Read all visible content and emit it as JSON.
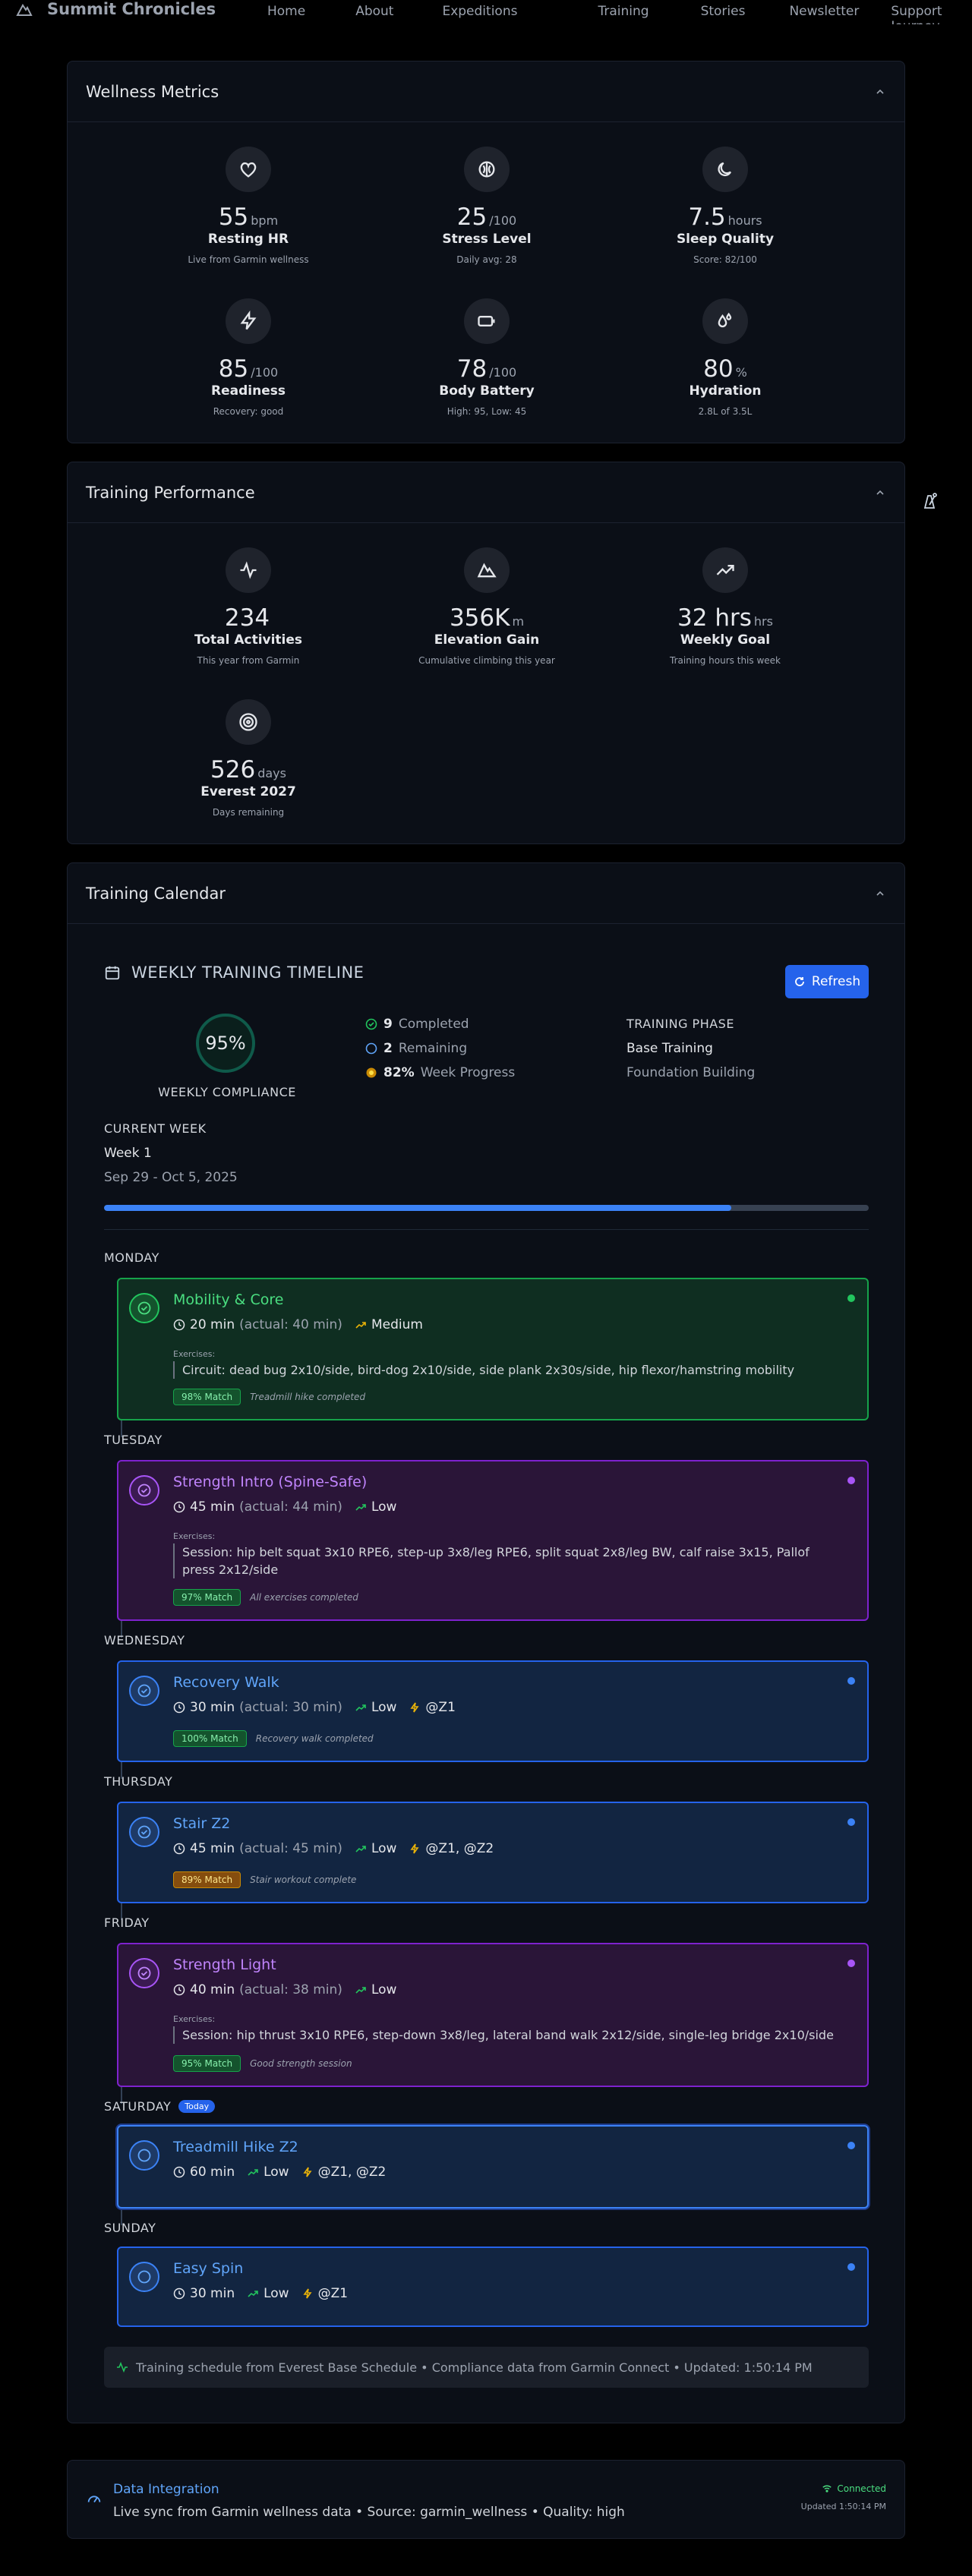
{
  "nav": {
    "brand": "Summit Chronicles",
    "links": [
      "Home",
      "About",
      "Expeditions",
      "Training",
      "Stories",
      "Newsletter",
      "Support Journey"
    ]
  },
  "wellness": {
    "title": "Wellness Metrics",
    "metrics": [
      {
        "icon": "heart-icon",
        "value": "55",
        "unit": "bpm",
        "label": "Resting HR",
        "sub": "Live from Garmin wellness"
      },
      {
        "icon": "brain-icon",
        "value": "25",
        "unit": "/100",
        "label": "Stress Level",
        "sub": "Daily avg: 28"
      },
      {
        "icon": "moon-icon",
        "value": "7.5",
        "unit": "hours",
        "label": "Sleep Quality",
        "sub": "Score: 82/100"
      },
      {
        "icon": "bolt-icon",
        "value": "85",
        "unit": "/100",
        "label": "Readiness",
        "sub": "Recovery: good"
      },
      {
        "icon": "battery-icon",
        "value": "78",
        "unit": "/100",
        "label": "Body Battery",
        "sub": "High: 95, Low: 45"
      },
      {
        "icon": "droplets-icon",
        "value": "80",
        "unit": "%",
        "label": "Hydration",
        "sub": "2.8L of 3.5L"
      }
    ]
  },
  "performance": {
    "title": "Training Performance",
    "metrics": [
      {
        "icon": "activity-icon",
        "value": "234",
        "unit": "",
        "label": "Total Activities",
        "sub": "This year from Garmin"
      },
      {
        "icon": "mountain-icon",
        "value": "356K",
        "unit": "m",
        "label": "Elevation Gain",
        "sub": "Cumulative climbing this year"
      },
      {
        "icon": "trending-up-icon",
        "value": "32 hrs",
        "unit": "hrs",
        "label": "Weekly Goal",
        "sub": "Training hours this week"
      },
      {
        "icon": "target-icon",
        "value": "526",
        "unit": "days",
        "label": "Everest 2027",
        "sub": "Days remaining"
      }
    ]
  },
  "calendar": {
    "title": "Training Calendar",
    "timeline_title": "WEEKLY TRAINING TIMELINE",
    "refresh_label": "Refresh",
    "compliance": "95%",
    "compliance_label": "WEEKLY COMPLIANCE",
    "completed_num": "9",
    "completed_label": "Completed",
    "remaining_num": "2",
    "remaining_label": "Remaining",
    "progress_num": "82%",
    "progress_label": "Week Progress",
    "progress_fraction": 0.82,
    "phase_label": "TRAINING PHASE",
    "phase_value": "Base Training",
    "phase_sub": "Foundation Building",
    "week_label": "CURRENT WEEK",
    "week_value": "Week 1",
    "week_dates": "Sep 29 - Oct 5, 2025",
    "today_badge": "Today",
    "exercises_label": "Exercises:",
    "days": [
      {
        "day": "MONDAY",
        "title": "Mobility & Core",
        "duration": "20 min",
        "actual": "(actual: 40 min)",
        "intensity": "Medium",
        "zones": "",
        "exercises": "Circuit: dead bug 2x10/side, bird-dog 2x10/side, side plank 2x30s/side, hip flexor/hamstring mobility",
        "match": "98% Match",
        "note": "Treadmill hike completed"
      },
      {
        "day": "TUESDAY",
        "title": "Strength Intro (Spine-Safe)",
        "duration": "45 min",
        "actual": "(actual: 44 min)",
        "intensity": "Low",
        "zones": "",
        "exercises": "Session: hip belt squat 3x10 RPE6, step-up 3x8/leg RPE6, split squat 2x8/leg BW, calf raise 3x15, Pallof press 2x12/side",
        "match": "97% Match",
        "note": "All exercises completed"
      },
      {
        "day": "WEDNESDAY",
        "title": "Recovery Walk",
        "duration": "30 min",
        "actual": "(actual: 30 min)",
        "intensity": "Low",
        "zones": "@Z1",
        "exercises": "",
        "match": "100% Match",
        "note": "Recovery walk completed"
      },
      {
        "day": "THURSDAY",
        "title": "Stair Z2",
        "duration": "45 min",
        "actual": "(actual: 45 min)",
        "intensity": "Low",
        "zones": "@Z1, @Z2",
        "exercises": "",
        "match": "89% Match",
        "note": "Stair workout complete"
      },
      {
        "day": "FRIDAY",
        "title": "Strength Light",
        "duration": "40 min",
        "actual": "(actual: 38 min)",
        "intensity": "Low",
        "zones": "",
        "exercises": "Session: hip thrust 3x10 RPE6, step-down 3x8/leg, lateral band walk 2x12/side, single-leg bridge 2x10/side",
        "match": "95% Match",
        "note": "Good strength session"
      },
      {
        "day": "SATURDAY",
        "title": "Treadmill Hike Z2",
        "duration": "60 min",
        "actual": "",
        "intensity": "Low",
        "zones": "@Z1, @Z2",
        "exercises": "",
        "match": "",
        "note": ""
      },
      {
        "day": "SUNDAY",
        "title": "Easy Spin",
        "duration": "30 min",
        "actual": "",
        "intensity": "Low",
        "zones": "@Z1",
        "exercises": "",
        "match": "",
        "note": ""
      }
    ],
    "footer_note": "Training schedule from Everest Base Schedule • Compliance data from Garmin Connect • Updated: 1:50:14 PM"
  },
  "integration": {
    "title": "Data Integration",
    "subtitle": "Live sync from Garmin wellness data • Source: garmin_wellness • Quality: high",
    "status": "Connected",
    "updated": "Updated 1:50:14 PM"
  },
  "colors": {
    "accent": "#2563eb",
    "completed_green": "#16a34a",
    "strength_purple": "#7e22ce",
    "cardio_blue": "#2563eb"
  }
}
